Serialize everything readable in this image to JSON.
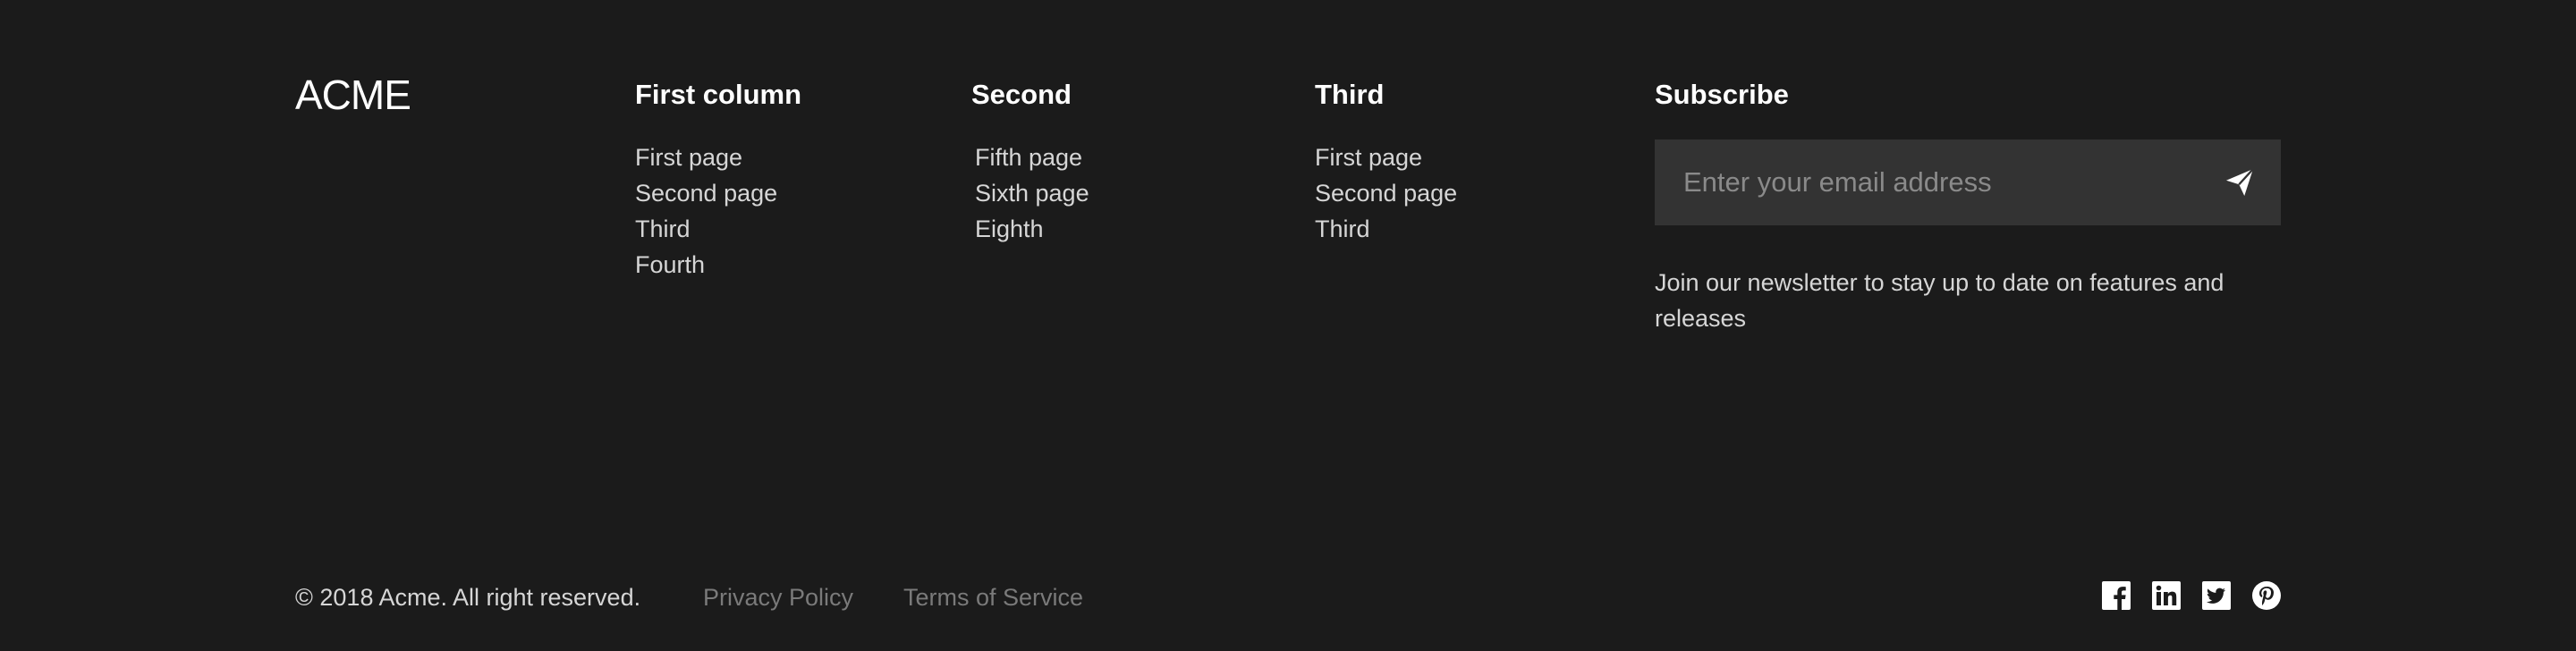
{
  "brand": {
    "logo_text": "ACME"
  },
  "columns": [
    {
      "title": "First column",
      "links": [
        "First page",
        "Second page",
        "Third",
        "Fourth"
      ]
    },
    {
      "title": "Second",
      "links": [
        "Fifth page",
        "Sixth page",
        "Eighth"
      ]
    },
    {
      "title": "Third",
      "links": [
        "First page",
        "Second page",
        "Third"
      ]
    }
  ],
  "subscribe": {
    "title": "Subscribe",
    "placeholder": "Enter your email address",
    "value": "",
    "send_icon": "paper-plane-icon",
    "description": "Join our newsletter to stay up to date on features and releases"
  },
  "bottom_bar": {
    "copyright": "© 2018 Acme. All right reserved.",
    "privacy_label": "Privacy Policy",
    "terms_label": "Terms of Service",
    "social_icons": [
      "facebook-icon",
      "linkedin-icon",
      "twitter-icon",
      "pinterest-icon"
    ]
  },
  "colors": {
    "background": "#1b1b1b",
    "input_background": "#333333",
    "text_primary": "#ffffff",
    "text_secondary": "#d6d6d6",
    "text_muted": "#7a7a7a"
  }
}
